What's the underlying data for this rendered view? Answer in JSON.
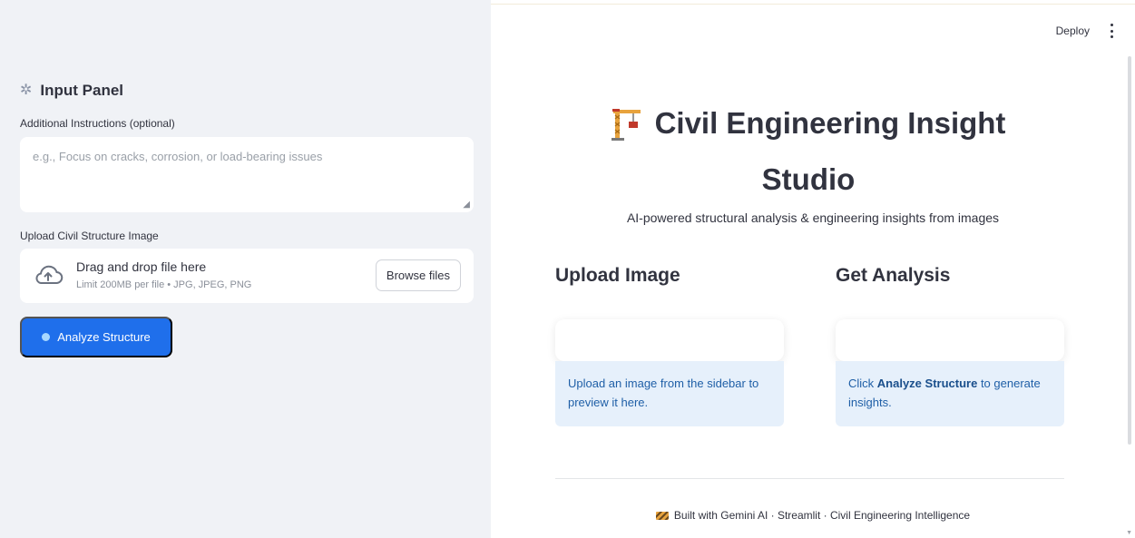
{
  "sidebar": {
    "panel_title": "Input Panel",
    "instructions_label": "Additional Instructions (optional)",
    "instructions_placeholder": "e.g., Focus on cracks, corrosion, or load-bearing issues",
    "upload_label": "Upload Civil Structure Image",
    "uploader": {
      "main_text": "Drag and drop file here",
      "sub_text": "Limit 200MB per file • JPG, JPEG, PNG",
      "browse_label": "Browse files"
    },
    "analyze_button_label": "Analyze Structure"
  },
  "header": {
    "deploy_label": "Deploy"
  },
  "main": {
    "title_line1": "Civil Engineering Insight",
    "title_line2": "Studio",
    "subtitle": "AI-powered structural analysis & engineering insights from images",
    "upload_column": {
      "heading": "Upload Image",
      "info_text": "Upload an image from the sidebar to preview it here."
    },
    "analysis_column": {
      "heading": "Get Analysis",
      "info_prefix": "Click ",
      "info_bold": "Analyze Structure",
      "info_suffix": " to generate insights."
    },
    "footer": "Built with Gemini AI · Streamlit · Civil Engineering Intelligence"
  },
  "icons": {
    "panel": "gear-icon",
    "upload": "cloud-upload-icon",
    "analyze": "search-icon",
    "title": "construction-crane-icon",
    "footer": "construction-barrier-icon",
    "menu": "kebab-menu-icon"
  },
  "colors": {
    "sidebar_bg": "#f0f2f6",
    "primary_button": "#1f6feb",
    "info_bg": "#e6f0fb",
    "info_text": "#1f5fa7"
  }
}
